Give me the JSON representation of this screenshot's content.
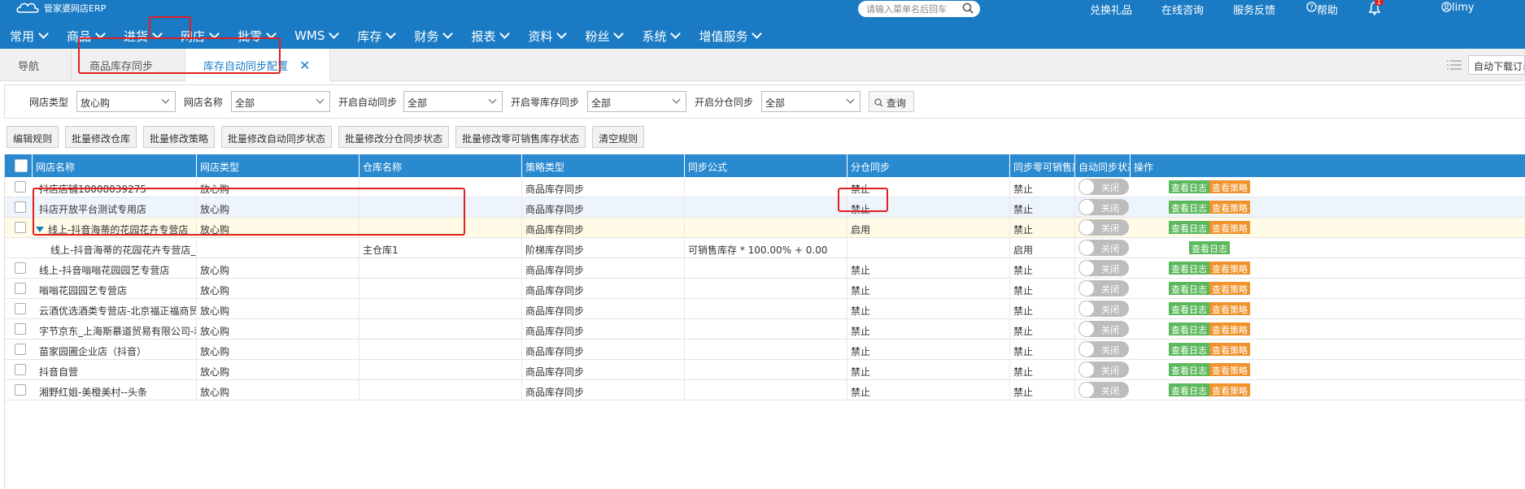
{
  "app": {
    "name": "管家婆网店ERP"
  },
  "search": {
    "placeholder": "请输入菜单名后回车"
  },
  "top_links": {
    "gift": "兑换礼品",
    "consult": "在线咨询",
    "feedback": "服务反馈",
    "help": "帮助",
    "user": "limy",
    "notification_badge": "1"
  },
  "nav": [
    "常用",
    "商品",
    "进货",
    "网店",
    "批零",
    "WMS",
    "库存",
    "财务",
    "报表",
    "资料",
    "粉丝",
    "系统",
    "增值服务"
  ],
  "tabs": [
    "导航",
    "商品库存同步",
    "库存自动同步配置"
  ],
  "tab_right": {
    "auto_download": "自动下载订单"
  },
  "filters": {
    "store_type_label": "网店类型",
    "store_type_value": "放心购",
    "store_name_label": "网店名称",
    "store_name_value": "全部",
    "auto_sync_label": "开启自动同步",
    "auto_sync_value": "全部",
    "zero_sync_label": "开启零库存同步",
    "zero_sync_value": "全部",
    "warehouse_sync_label": "开启分仓同步",
    "warehouse_sync_value": "全部",
    "query_label": "查询"
  },
  "actions": [
    "编辑规则",
    "批量修改仓库",
    "批量修改策略",
    "批量修改自动同步状态",
    "批量修改分仓同步状态",
    "批量修改零可销售库存状态",
    "清空规则"
  ],
  "columns": [
    "网店名称",
    "网店类型",
    "仓库名称",
    "策略类型",
    "同步公式",
    "分仓同步",
    "同步零可销售库存",
    "自动同步状态",
    "操作"
  ],
  "toggle_label": "关闭",
  "op_labels": {
    "view_log": "查看日志",
    "view_strategy": "查看策略"
  },
  "rows": [
    {
      "name": "抖店店铺18008039275",
      "type": "放心购",
      "warehouse": "",
      "strategy": "商品库存同步",
      "formula": "",
      "split": "禁止",
      "zero": "禁止"
    },
    {
      "name": "抖店开放平台测试专用店",
      "type": "放心购",
      "warehouse": "",
      "strategy": "商品库存同步",
      "formula": "",
      "split": "禁止",
      "zero": "禁止"
    },
    {
      "name": "线上-抖音海蒂的花园花卉专营店",
      "type": "放心购",
      "warehouse": "",
      "strategy": "商品库存同步",
      "formula": "",
      "split": "启用",
      "zero": "禁止"
    },
    {
      "name": "线上-抖音海蒂的花园花卉专营店_阶梯",
      "type": "",
      "warehouse": "主仓库1",
      "strategy": "阶梯库存同步",
      "formula": "可销售库存 * 100.00% + 0.00",
      "split": "",
      "zero": "启用"
    },
    {
      "name": "线上-抖音嗡嗡花园园艺专营店",
      "type": "放心购",
      "warehouse": "",
      "strategy": "商品库存同步",
      "formula": "",
      "split": "禁止",
      "zero": "禁止"
    },
    {
      "name": "嗡嗡花园园艺专营店",
      "type": "放心购",
      "warehouse": "",
      "strategy": "商品库存同步",
      "formula": "",
      "split": "禁止",
      "zero": "禁止"
    },
    {
      "name": "云酒优选酒类专营店-北京福正福商贸有…",
      "type": "放心购",
      "warehouse": "",
      "strategy": "商品库存同步",
      "formula": "",
      "split": "禁止",
      "zero": "禁止"
    },
    {
      "name": "字节京东_上海斯慕道贸易有限公司-利赓…",
      "type": "放心购",
      "warehouse": "",
      "strategy": "商品库存同步",
      "formula": "",
      "split": "禁止",
      "zero": "禁止"
    },
    {
      "name": "苗家园圃企业店（抖音）",
      "type": "放心购",
      "warehouse": "",
      "strategy": "商品库存同步",
      "formula": "",
      "split": "禁止",
      "zero": "禁止"
    },
    {
      "name": "抖音自营",
      "type": "放心购",
      "warehouse": "",
      "strategy": "商品库存同步",
      "formula": "",
      "split": "禁止",
      "zero": "禁止"
    },
    {
      "name": "湘野红姐-美橙美村--头条",
      "type": "放心购",
      "warehouse": "",
      "strategy": "商品库存同步",
      "formula": "",
      "split": "禁止",
      "zero": "禁止"
    }
  ],
  "colors": {
    "topbar": "#1a7bc4",
    "header": "#2a8ad0",
    "highlight_red": "#e02020",
    "row_selected": "#fffbe6",
    "row_alt": "#eef4fb"
  }
}
